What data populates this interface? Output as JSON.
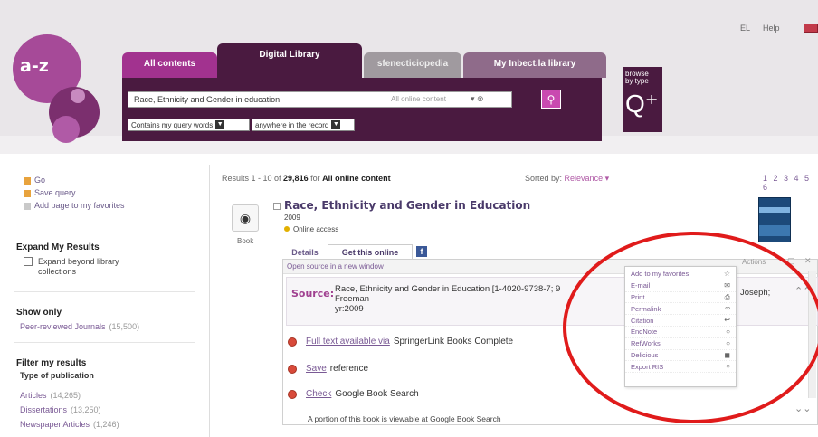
{
  "header": {
    "logo_text": "a-z",
    "top_links": [
      "EL",
      "Help"
    ],
    "tabs": [
      {
        "label": "All contents"
      },
      {
        "label": "Digital Library"
      },
      {
        "label": "sfenecticiopedia"
      },
      {
        "label": "My Inbect.la library"
      }
    ],
    "search": {
      "query": "Race, Ethnicity and Gender in education",
      "scope": "All online content",
      "scope_arrow": "▾ ⊗",
      "button_icon": "search-icon",
      "match_option": "Contains my query words",
      "field_option": "anywhere in the record"
    },
    "browse_by_type": {
      "line1": "browse",
      "line2": "by type",
      "icon": "magnifier-plus-icon"
    }
  },
  "sidebar": {
    "links": [
      {
        "label": "Go",
        "icon": "folder-icon"
      },
      {
        "label": "Save query",
        "icon": "folder-icon"
      },
      {
        "label": "Add page to my favorites",
        "icon": "star-icon"
      }
    ],
    "expand": {
      "heading": "Expand My Results",
      "checkbox_label": "Expand beyond library collections"
    },
    "show_only": {
      "heading": "Show only",
      "items": [
        {
          "label": "Peer-reviewed Journals",
          "count": "(15,500)"
        }
      ]
    },
    "filter": {
      "heading": "Filter my results",
      "subheading": "Type of publication",
      "items": [
        {
          "label": "Articles",
          "count": "(14,265)"
        },
        {
          "label": "Dissertations",
          "count": "(13,250)"
        },
        {
          "label": "Newspaper Articles",
          "count": "(1,246)"
        }
      ]
    }
  },
  "results": {
    "prefix": "Results 1 - 10 of",
    "total": "29,816",
    "for_text": "for",
    "scope": "All online content",
    "sort_label": "Sorted by:",
    "sort_value": "Relevance ▾",
    "pages": "1 2 3 4 5 6",
    "record": {
      "type_label": "Book",
      "title": "Race, Ethnicity and Gender in Education",
      "year": "2009",
      "availability": "Online access",
      "tabs": {
        "details": "Details",
        "get_online": "Get this online",
        "facebook": "f"
      },
      "open_new_window": "Open source in a new window",
      "actions_label": "Actions",
      "actions_controls": "▢ ✕",
      "source_label": "Source:",
      "source_text": "Race, Ethnicity and Gender in Education [1-4020-9738-7; 9",
      "source_author": "Freeman",
      "source_year": "yr:2009",
      "source_extra": "Joseph;",
      "links": [
        {
          "link": "Full text available via",
          "text": "SpringerLink Books Complete"
        },
        {
          "link": "Save",
          "text": "reference"
        },
        {
          "link": "Check",
          "text": "Google Book Search"
        }
      ],
      "note": "A portion of this book is viewable at Google Book Search"
    }
  },
  "actions_menu": [
    {
      "label": "Add to my favorites",
      "icon": "star-icon"
    },
    {
      "label": "E-mail",
      "icon": "email-icon"
    },
    {
      "label": "Print",
      "icon": "print-icon"
    },
    {
      "label": "Permalink",
      "icon": "link-icon"
    },
    {
      "label": "Citation",
      "icon": "citation-icon"
    },
    {
      "label": "EndNote",
      "icon": "endnote-icon"
    },
    {
      "label": "RefWorks",
      "icon": "refworks-icon"
    },
    {
      "label": "Delicious",
      "icon": "delicious-icon"
    },
    {
      "label": "Export RIS",
      "icon": "export-icon"
    }
  ],
  "colors": {
    "brand_purple": "#4a1a40",
    "accent_magenta": "#a2328f",
    "annotation_red": "#e01b1b"
  }
}
